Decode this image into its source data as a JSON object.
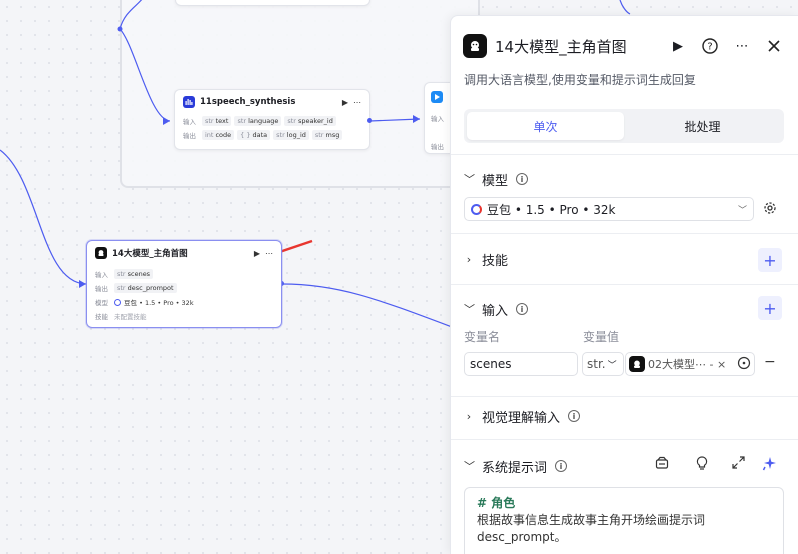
{
  "canvas": {
    "nodes": {
      "speech": {
        "title": "11speech_synthesis",
        "input_label": "输入",
        "output_label": "输出",
        "inputs": [
          {
            "type": "str",
            "name": "text"
          },
          {
            "type": "str",
            "name": "language"
          },
          {
            "type": "str",
            "name": "speaker_id"
          }
        ],
        "outputs": [
          {
            "type": "int",
            "name": "code"
          },
          {
            "type": "{ }",
            "name": "data"
          },
          {
            "type": "str",
            "name": "log_id"
          },
          {
            "type": "str",
            "name": "msg"
          }
        ]
      },
      "partial": {
        "input_label": "输入",
        "output_label": "输出"
      },
      "llm": {
        "title": "14大模型_主角首图",
        "input_label": "输入",
        "output_label": "输出",
        "model_label": "模型",
        "skills_label": "技能",
        "input_var": {
          "type": "str",
          "name": "scenes"
        },
        "output_var": {
          "type": "str",
          "name": "desc_prompot"
        },
        "model_value": "豆包 • 1.5 • Pro • 32k",
        "skills_value": "未配置技能"
      }
    }
  },
  "panel": {
    "title": "14大模型_主角首图",
    "description": "调用大语言模型,使用变量和提示词生成回复",
    "tabs": [
      {
        "label": "单次",
        "active": true
      },
      {
        "label": "批处理",
        "active": false
      }
    ],
    "sections": {
      "model": {
        "label": "模型",
        "value": "豆包 • 1.5 • Pro • 32k"
      },
      "skills": {
        "label": "技能"
      },
      "input": {
        "label": "输入",
        "col_name": "变量名",
        "col_value": "变量值",
        "var_name": "scenes",
        "var_type": "str.",
        "var_ref": "02大模型⋯ - ×"
      },
      "vision": {
        "label": "视觉理解输入"
      },
      "system_prompt": {
        "label": "系统提示词",
        "heading": "# 角色",
        "body": "根据故事信息生成故事主角开场绘画提示词desc_prompt。"
      }
    }
  },
  "colors": {
    "accent": "#4d5cf0",
    "arrow": "#e8362f",
    "wire": "#4d5cf0"
  }
}
